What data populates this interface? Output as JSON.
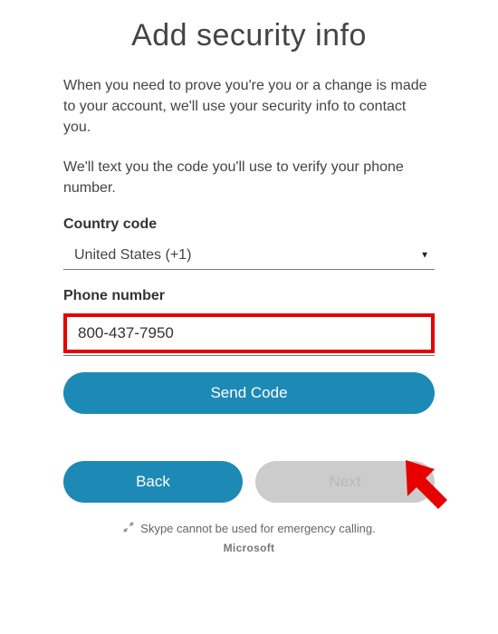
{
  "title": "Add security info",
  "description1": "When you need to prove you're you or a change is made to your account, we'll use your security info to contact you.",
  "description2": "We'll text you the code you'll use to verify your phone number.",
  "countryCode": {
    "label": "Country code",
    "selected": "United States (+1)"
  },
  "phone": {
    "label": "Phone number",
    "value": "800-437-7950"
  },
  "buttons": {
    "sendCode": "Send Code",
    "back": "Back",
    "next": "Next"
  },
  "footer": {
    "emergency": "Skype cannot be used for emergency calling.",
    "brand": "Microsoft"
  },
  "annotation": {
    "arrowColor": "#e60000"
  }
}
